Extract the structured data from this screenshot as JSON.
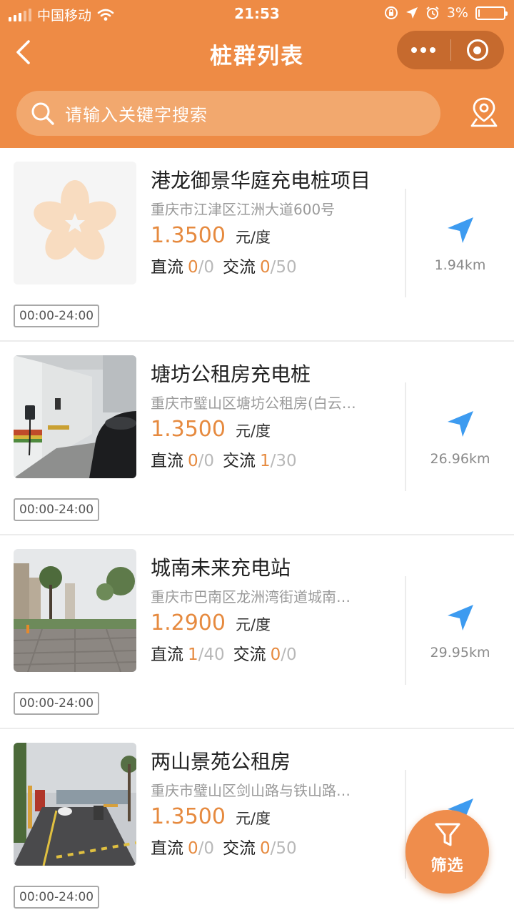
{
  "status_bar": {
    "carrier": "中国移动",
    "time": "21:53",
    "battery_percent": "3%",
    "battery_level": 0.03
  },
  "nav": {
    "title": "桩群列表",
    "back_icon": "chevron-left-icon",
    "more_icon": "more-dots-icon",
    "close_icon": "target-circle-icon"
  },
  "search": {
    "placeholder": "请输入关键字搜索",
    "icon": "search-icon",
    "map_icon": "map-pin-icon"
  },
  "labels": {
    "dc": "直流",
    "ac": "交流",
    "price_unit": "元/度"
  },
  "stations": [
    {
      "name": "港龙御景华庭充电桩项目",
      "address": "重庆市江津区江洲大道600号",
      "price": "1.3500",
      "dc_available": "0",
      "dc_total": "/0",
      "ac_available": "0",
      "ac_total": "/50",
      "distance": "1.94km",
      "hours": "00:00-24:00",
      "image": "placeholder-flower-logo"
    },
    {
      "name": "塘坊公租房充电桩",
      "address": "重庆市璧山区塘坊公租房(白云…",
      "price": "1.3500",
      "dc_available": "0",
      "dc_total": "/0",
      "ac_available": "1",
      "ac_total": "/30",
      "distance": "26.96km",
      "hours": "00:00-24:00",
      "image": "garage-photo"
    },
    {
      "name": "城南未来充电站",
      "address": "重庆市巴南区龙洲湾街道城南…",
      "price": "1.2900",
      "dc_available": "1",
      "dc_total": "/40",
      "ac_available": "0",
      "ac_total": "/0",
      "distance": "29.95km",
      "hours": "00:00-24:00",
      "image": "plaza-photo"
    },
    {
      "name": "两山景苑公租房",
      "address": "重庆市璧山区剑山路与铁山路…",
      "price": "1.3500",
      "dc_available": "0",
      "dc_total": "/0",
      "ac_available": "0",
      "ac_total": "/50",
      "distance": "",
      "hours": "00:00-24:00",
      "image": "road-gate-photo"
    }
  ],
  "filter_button": {
    "label": "筛选",
    "icon": "funnel-icon"
  },
  "colors": {
    "brand_orange": "#ee8b45",
    "price_orange": "#e68a3f",
    "nav_blue": "#3d9bf0"
  }
}
